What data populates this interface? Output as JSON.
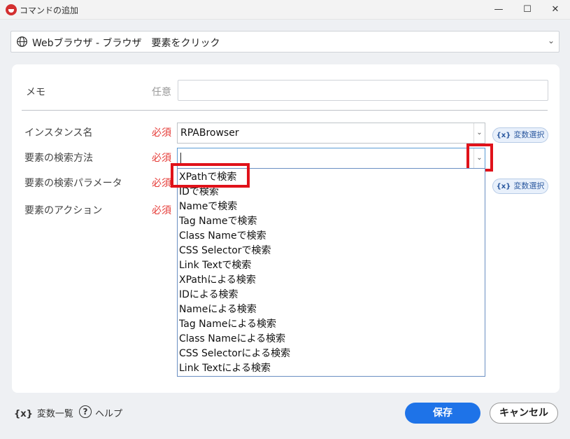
{
  "window": {
    "title": "コマンドの追加",
    "minimize": "—",
    "maximize": "☐",
    "close": "✕"
  },
  "command": {
    "selected": "Webブラウザ - ブラウザ　要素をクリック",
    "icon": "globe-icon"
  },
  "form": {
    "memo": {
      "label": "メモ",
      "tag": "任意",
      "value": ""
    },
    "instance": {
      "label": "インスタンス名",
      "tag": "必須",
      "value": "RPABrowser"
    },
    "method": {
      "label": "要素の検索方法",
      "tag": "必須",
      "value": ""
    },
    "param": {
      "label": "要素の検索パラメータ",
      "tag": "必須",
      "value": ""
    },
    "action": {
      "label": "要素のアクション",
      "tag": "必須",
      "value": ""
    },
    "var_select_label": "変数選択",
    "var_icon_text": "{x}"
  },
  "dropdown": {
    "options": [
      "XPathで検索",
      "IDで検索",
      "Nameで検索",
      "Tag Nameで検索",
      "Class Nameで検索",
      "CSS Selectorで検索",
      "Link Textで検索",
      "XPathによる検索",
      "IDによる検索",
      "Nameによる検索",
      "Tag Nameによる検索",
      "Class Nameによる検索",
      "CSS Selectorによる検索",
      "Link Textによる検索"
    ],
    "highlighted": "XPathで検索"
  },
  "footer": {
    "vars_icon": "{x}",
    "vars_label": "変数一覧",
    "help_icon": "?",
    "help_label": "ヘルプ",
    "save": "保存",
    "cancel": "キャンセル"
  },
  "colors": {
    "required": "#e53935",
    "accent": "#1e73e8",
    "highlight_box": "#e0121a"
  }
}
